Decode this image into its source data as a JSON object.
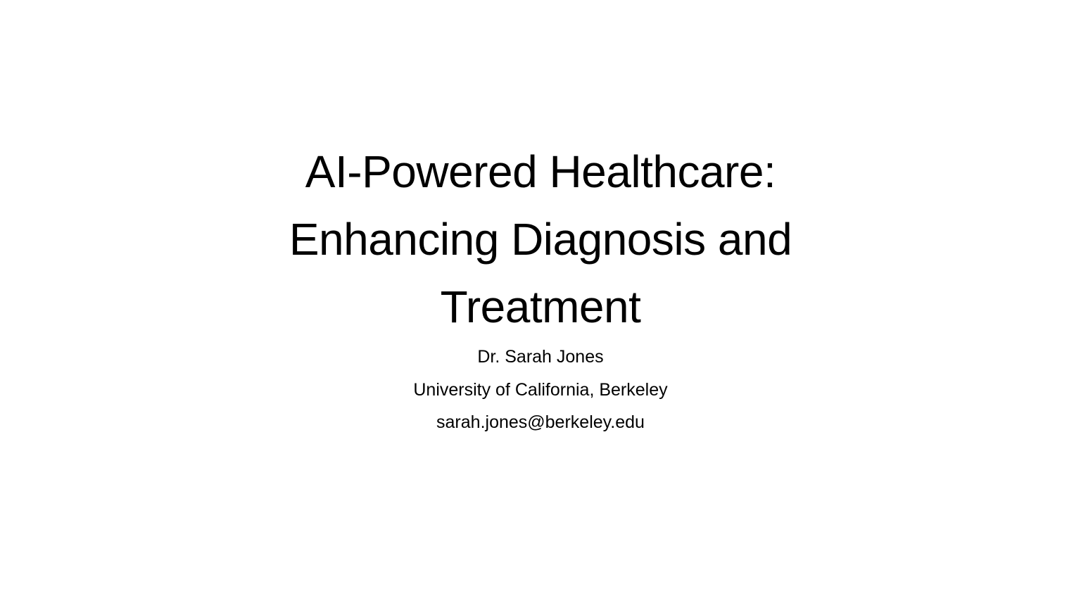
{
  "slide": {
    "title_lines": [
      "AI-Powered Healthcare:",
      "Enhancing Diagnosis and",
      "Treatment"
    ],
    "author": "Dr. Sarah Jones",
    "affiliation": "University of California, Berkeley",
    "email": "sarah.jones@berkeley.edu"
  }
}
